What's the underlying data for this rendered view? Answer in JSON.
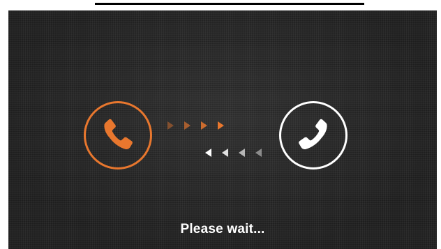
{
  "screen": {
    "status_text": "Please wait...",
    "caller_icon": "phone-handset-icon",
    "callee_icon": "phone-handset-icon",
    "outgoing_arrow_count": 4,
    "incoming_arrow_count": 4
  },
  "colors": {
    "background": "#2a2a2a",
    "caller_accent": "#e8772e",
    "callee_accent": "#ffffff",
    "text": "#ffffff"
  }
}
